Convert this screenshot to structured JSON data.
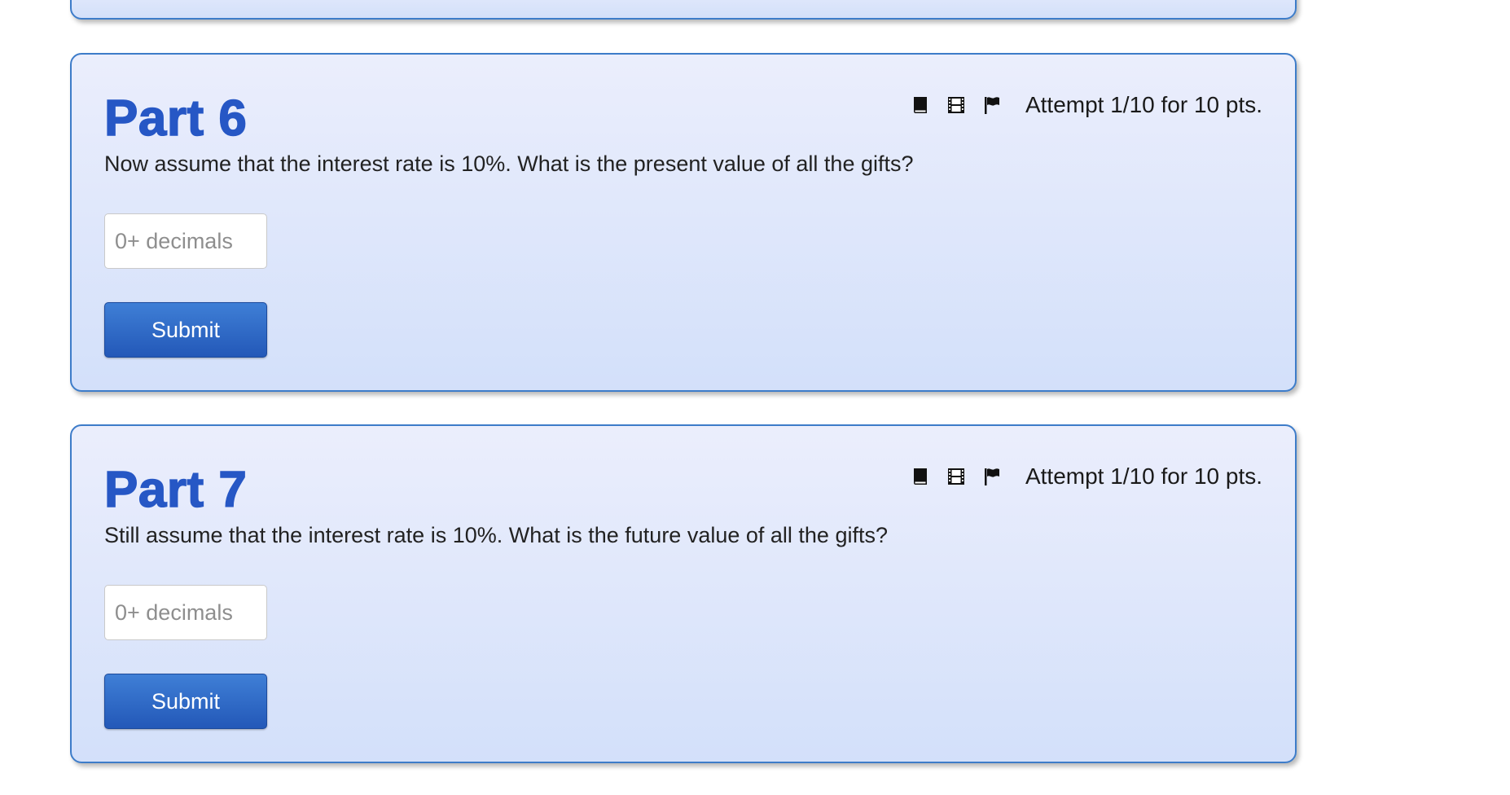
{
  "parts": [
    {
      "title": "Part 6",
      "attempt": "Attempt 1/10 for 10 pts.",
      "question": "Now assume that the interest rate is 10%. What is the present value of all the gifts?",
      "input_placeholder": "0+ decimals",
      "input_value": "",
      "submit_label": "Submit"
    },
    {
      "title": "Part 7",
      "attempt": "Attempt 1/10 for 10 pts.",
      "question": "Still assume that the interest rate is 10%. What is the future value of all the gifts?",
      "input_placeholder": "0+ decimals",
      "input_value": "",
      "submit_label": "Submit"
    }
  ],
  "icons": [
    "book-icon",
    "film-icon",
    "flag-icon"
  ],
  "colors": {
    "title": "#2657c5",
    "card_border": "#3d7cc9",
    "card_background_top": "#ebeefc",
    "card_background_bottom": "#d3e0fa",
    "button": "#2f6ac7"
  }
}
